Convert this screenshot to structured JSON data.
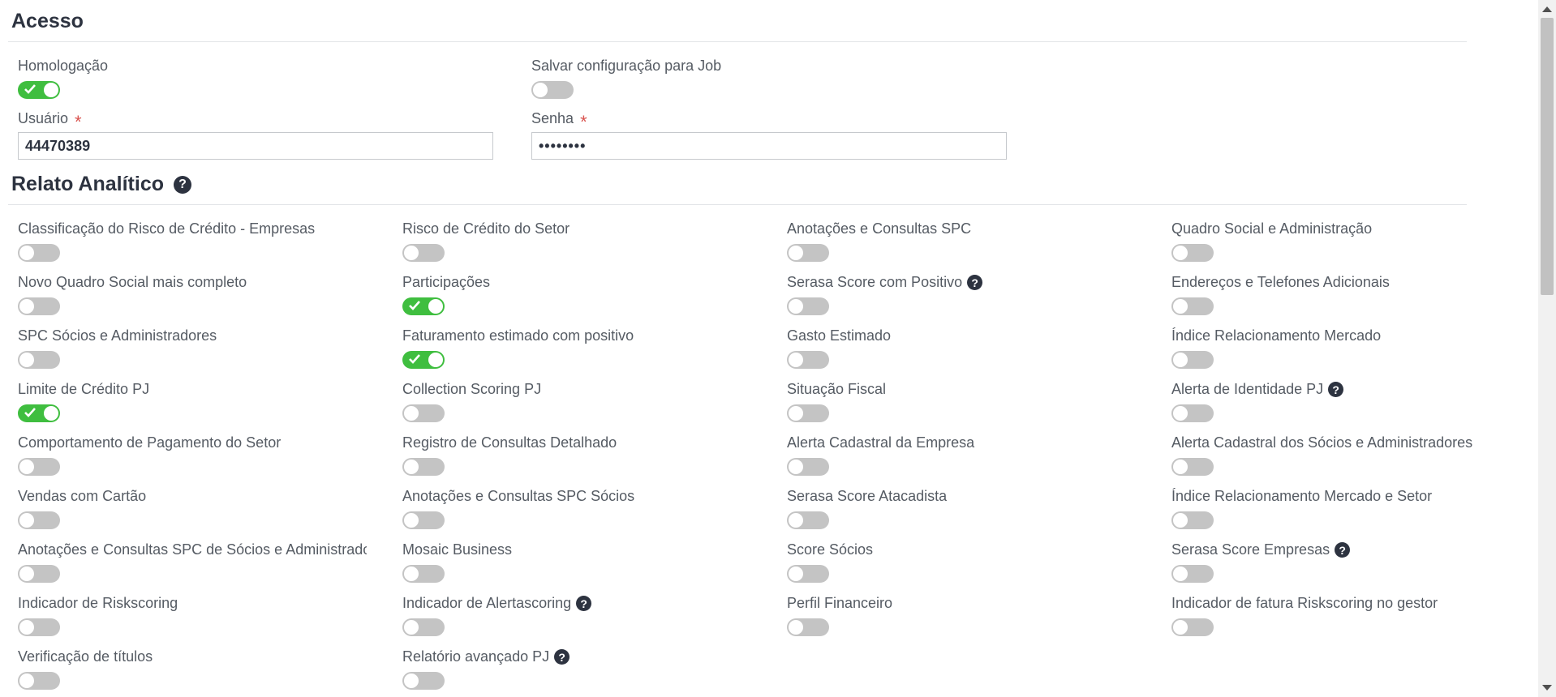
{
  "acesso": {
    "title": "Acesso",
    "homologacao": {
      "label": "Homologação",
      "on": true
    },
    "salvar_job": {
      "label": "Salvar configuração para Job",
      "on": false
    },
    "usuario": {
      "label": "Usuário",
      "required": "*",
      "value": "44470389"
    },
    "senha": {
      "label": "Senha",
      "required": "*",
      "value": "••••••••"
    }
  },
  "relato": {
    "title": "Relato Analítico",
    "help_glyph": "?",
    "columns": [
      [
        {
          "label": "Classificação do Risco de Crédito - Empresas",
          "on": false
        },
        {
          "label": "Novo Quadro Social mais completo",
          "on": false
        },
        {
          "label": "SPC Sócios e Administradores",
          "on": false
        },
        {
          "label": "Limite de Crédito PJ",
          "on": true
        },
        {
          "label": "Comportamento de Pagamento do Setor",
          "on": false
        },
        {
          "label": "Vendas com Cartão",
          "on": false
        },
        {
          "label": "Anotações e Consultas SPC de Sócios e Administradores",
          "on": false
        },
        {
          "label": "Indicador de Riskscoring",
          "on": false
        },
        {
          "label": "Verificação de títulos",
          "on": false
        }
      ],
      [
        {
          "label": "Risco de Crédito do Setor",
          "on": false
        },
        {
          "label": "Participações",
          "on": true
        },
        {
          "label": "Faturamento estimado com positivo",
          "on": true
        },
        {
          "label": "Collection Scoring PJ",
          "on": false
        },
        {
          "label": "Registro de Consultas Detalhado",
          "on": false
        },
        {
          "label": "Anotações e Consultas SPC Sócios",
          "on": false
        },
        {
          "label": "Mosaic Business",
          "on": false
        },
        {
          "label": "Indicador de Alertascoring",
          "on": false,
          "help": true
        },
        {
          "label": "Relatório avançado PJ",
          "on": false,
          "help": true
        }
      ],
      [
        {
          "label": "Anotações e Consultas SPC",
          "on": false
        },
        {
          "label": "Serasa Score com Positivo",
          "on": false,
          "help": true
        },
        {
          "label": "Gasto Estimado",
          "on": false
        },
        {
          "label": "Situação Fiscal",
          "on": false
        },
        {
          "label": "Alerta Cadastral da Empresa",
          "on": false
        },
        {
          "label": "Serasa Score Atacadista",
          "on": false
        },
        {
          "label": "Score Sócios",
          "on": false
        },
        {
          "label": "Perfil Financeiro",
          "on": false
        }
      ],
      [
        {
          "label": "Quadro Social e Administração",
          "on": false
        },
        {
          "label": "Endereços e Telefones Adicionais",
          "on": false
        },
        {
          "label": "Índice Relacionamento Mercado",
          "on": false
        },
        {
          "label": "Alerta de Identidade PJ",
          "on": false,
          "help": true
        },
        {
          "label": "Alerta Cadastral dos Sócios e Administradores",
          "on": false
        },
        {
          "label": "Índice Relacionamento Mercado e Setor",
          "on": false
        },
        {
          "label": "Serasa Score Empresas",
          "on": false,
          "help": true
        },
        {
          "label": "Indicador de fatura Riskscoring no gestor",
          "on": false
        }
      ]
    ]
  },
  "colors": {
    "toggle_on": "#3fbe3f",
    "toggle_off": "#c4c4c4",
    "required": "#d9534f",
    "heading": "#2d3340"
  }
}
